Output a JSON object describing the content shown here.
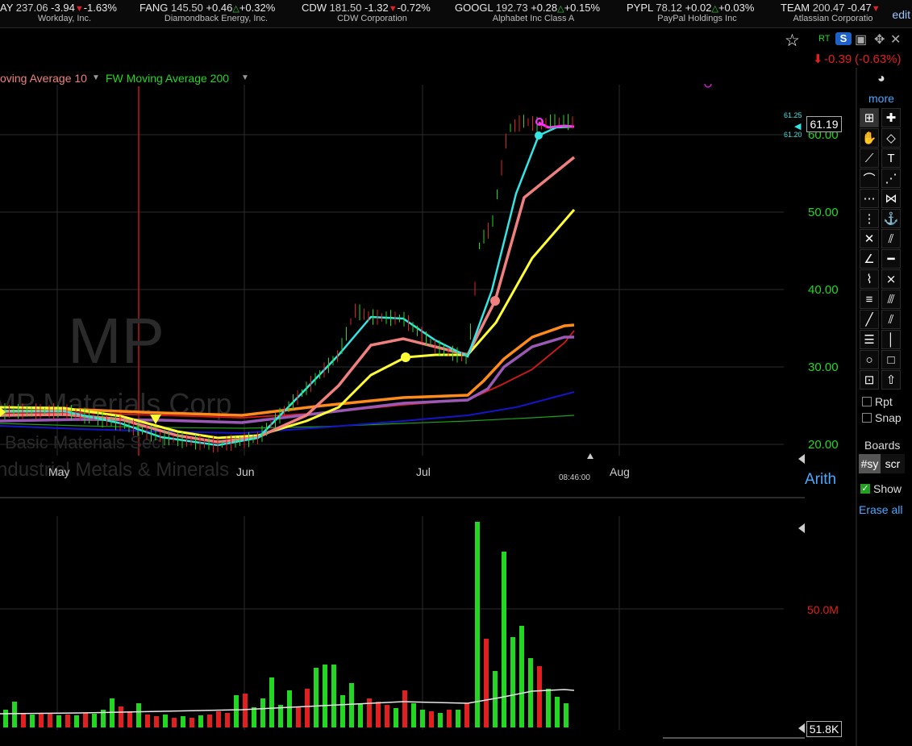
{
  "ticker": [
    {
      "symbol": "AY",
      "price": "237.06",
      "change": "-3.94",
      "pct": "-1.63%",
      "dir": "down",
      "name": "Workday, Inc."
    },
    {
      "symbol": "FANG",
      "price": "145.50",
      "change": "+0.46",
      "pct": "+0.32%",
      "dir": "up",
      "name": "Diamondback Energy, Inc."
    },
    {
      "symbol": "CDW",
      "price": "181.50",
      "change": "-1.32",
      "pct": "-0.72%",
      "dir": "down",
      "name": "CDW Corporation"
    },
    {
      "symbol": "GOOGL",
      "price": "192.73",
      "change": "+0.28",
      "pct": "+0.15%",
      "dir": "up",
      "name": "Alphabet Inc Class A"
    },
    {
      "symbol": "PYPL",
      "price": "78.12",
      "change": "+0.02",
      "pct": "+0.03%",
      "dir": "up",
      "name": "PayPal Holdings Inc"
    },
    {
      "symbol": "TEAM",
      "price": "200.47",
      "change": "-0.47",
      "pct": "",
      "dir": "down",
      "name": "Atlassian Corporatio"
    }
  ],
  "edit_label": "edit",
  "header": {
    "change": "-0.39",
    "pct": "(-0.63%)",
    "rt_label": "RT",
    "s_label": "S"
  },
  "indicators": {
    "ma10": "oving Average 10",
    "ma200": "FW Moving Average 200"
  },
  "watermark": {
    "symbol": "MP",
    "company": "MP Materials Corp",
    "sector": "Basic Materials Sect",
    "industry": "ndustrial Metals & Minerals"
  },
  "price_axis": {
    "labels": [
      "60.00",
      "50.00",
      "40.00",
      "30.00",
      "20.00"
    ],
    "current": "61.19",
    "mini_high": "61.25",
    "mini_low": "61.20"
  },
  "months": [
    "May",
    "Jun",
    "Jul",
    "Aug"
  ],
  "time_label": "08:46:00",
  "volume_axis": {
    "label": "50.0M",
    "current": "51.8K"
  },
  "toolbar": {
    "more": "more",
    "rpt": "Rpt",
    "snap": "Snap",
    "boards": "Boards",
    "tab1": "#sy",
    "tab2": "scr",
    "arith": "Arith",
    "show": "Show",
    "erase": "Erase all"
  },
  "icons": [
    "crosshair-icon",
    "grid-cross-icon",
    "hand-icon",
    "eraser-icon",
    "line-icon",
    "text-icon",
    "arc-icon",
    "fan-icon",
    "dots-grid-icon",
    "fib-icon",
    "vdots-icon",
    "anchor-icon",
    "x-lines-icon",
    "parallel-icon",
    "angle-fan-icon",
    "hline-icon",
    "zigzag-icon",
    "gann-icon",
    "hlines-icon",
    "channel-icon",
    "diag-icon",
    "diag-double-icon",
    "hdash-icon",
    "vline-icon",
    "circle-icon",
    "square-icon",
    "measure-icon",
    "arrow-up-icon"
  ],
  "colors": {
    "up": "#22d622",
    "down": "#e02020",
    "accent_cyan": "#33e5e5",
    "ma_salmon": "#f08080",
    "ma_yellow": "#ffff33"
  }
}
